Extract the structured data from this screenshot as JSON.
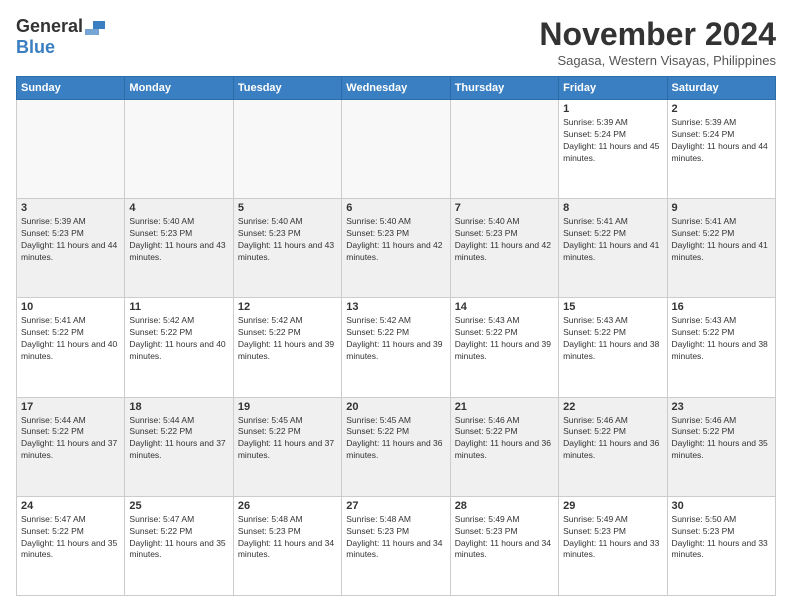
{
  "logo": {
    "general": "General",
    "blue": "Blue"
  },
  "header": {
    "month": "November 2024",
    "location": "Sagasa, Western Visayas, Philippines"
  },
  "weekdays": [
    "Sunday",
    "Monday",
    "Tuesday",
    "Wednesday",
    "Thursday",
    "Friday",
    "Saturday"
  ],
  "weeks": [
    [
      {
        "day": "",
        "info": ""
      },
      {
        "day": "",
        "info": ""
      },
      {
        "day": "",
        "info": ""
      },
      {
        "day": "",
        "info": ""
      },
      {
        "day": "",
        "info": ""
      },
      {
        "day": "1",
        "info": "Sunrise: 5:39 AM\nSunset: 5:24 PM\nDaylight: 11 hours and 45 minutes."
      },
      {
        "day": "2",
        "info": "Sunrise: 5:39 AM\nSunset: 5:24 PM\nDaylight: 11 hours and 44 minutes."
      }
    ],
    [
      {
        "day": "3",
        "info": "Sunrise: 5:39 AM\nSunset: 5:23 PM\nDaylight: 11 hours and 44 minutes."
      },
      {
        "day": "4",
        "info": "Sunrise: 5:40 AM\nSunset: 5:23 PM\nDaylight: 11 hours and 43 minutes."
      },
      {
        "day": "5",
        "info": "Sunrise: 5:40 AM\nSunset: 5:23 PM\nDaylight: 11 hours and 43 minutes."
      },
      {
        "day": "6",
        "info": "Sunrise: 5:40 AM\nSunset: 5:23 PM\nDaylight: 11 hours and 42 minutes."
      },
      {
        "day": "7",
        "info": "Sunrise: 5:40 AM\nSunset: 5:23 PM\nDaylight: 11 hours and 42 minutes."
      },
      {
        "day": "8",
        "info": "Sunrise: 5:41 AM\nSunset: 5:22 PM\nDaylight: 11 hours and 41 minutes."
      },
      {
        "day": "9",
        "info": "Sunrise: 5:41 AM\nSunset: 5:22 PM\nDaylight: 11 hours and 41 minutes."
      }
    ],
    [
      {
        "day": "10",
        "info": "Sunrise: 5:41 AM\nSunset: 5:22 PM\nDaylight: 11 hours and 40 minutes."
      },
      {
        "day": "11",
        "info": "Sunrise: 5:42 AM\nSunset: 5:22 PM\nDaylight: 11 hours and 40 minutes."
      },
      {
        "day": "12",
        "info": "Sunrise: 5:42 AM\nSunset: 5:22 PM\nDaylight: 11 hours and 39 minutes."
      },
      {
        "day": "13",
        "info": "Sunrise: 5:42 AM\nSunset: 5:22 PM\nDaylight: 11 hours and 39 minutes."
      },
      {
        "day": "14",
        "info": "Sunrise: 5:43 AM\nSunset: 5:22 PM\nDaylight: 11 hours and 39 minutes."
      },
      {
        "day": "15",
        "info": "Sunrise: 5:43 AM\nSunset: 5:22 PM\nDaylight: 11 hours and 38 minutes."
      },
      {
        "day": "16",
        "info": "Sunrise: 5:43 AM\nSunset: 5:22 PM\nDaylight: 11 hours and 38 minutes."
      }
    ],
    [
      {
        "day": "17",
        "info": "Sunrise: 5:44 AM\nSunset: 5:22 PM\nDaylight: 11 hours and 37 minutes."
      },
      {
        "day": "18",
        "info": "Sunrise: 5:44 AM\nSunset: 5:22 PM\nDaylight: 11 hours and 37 minutes."
      },
      {
        "day": "19",
        "info": "Sunrise: 5:45 AM\nSunset: 5:22 PM\nDaylight: 11 hours and 37 minutes."
      },
      {
        "day": "20",
        "info": "Sunrise: 5:45 AM\nSunset: 5:22 PM\nDaylight: 11 hours and 36 minutes."
      },
      {
        "day": "21",
        "info": "Sunrise: 5:46 AM\nSunset: 5:22 PM\nDaylight: 11 hours and 36 minutes."
      },
      {
        "day": "22",
        "info": "Sunrise: 5:46 AM\nSunset: 5:22 PM\nDaylight: 11 hours and 36 minutes."
      },
      {
        "day": "23",
        "info": "Sunrise: 5:46 AM\nSunset: 5:22 PM\nDaylight: 11 hours and 35 minutes."
      }
    ],
    [
      {
        "day": "24",
        "info": "Sunrise: 5:47 AM\nSunset: 5:22 PM\nDaylight: 11 hours and 35 minutes."
      },
      {
        "day": "25",
        "info": "Sunrise: 5:47 AM\nSunset: 5:22 PM\nDaylight: 11 hours and 35 minutes."
      },
      {
        "day": "26",
        "info": "Sunrise: 5:48 AM\nSunset: 5:23 PM\nDaylight: 11 hours and 34 minutes."
      },
      {
        "day": "27",
        "info": "Sunrise: 5:48 AM\nSunset: 5:23 PM\nDaylight: 11 hours and 34 minutes."
      },
      {
        "day": "28",
        "info": "Sunrise: 5:49 AM\nSunset: 5:23 PM\nDaylight: 11 hours and 34 minutes."
      },
      {
        "day": "29",
        "info": "Sunrise: 5:49 AM\nSunset: 5:23 PM\nDaylight: 11 hours and 33 minutes."
      },
      {
        "day": "30",
        "info": "Sunrise: 5:50 AM\nSunset: 5:23 PM\nDaylight: 11 hours and 33 minutes."
      }
    ]
  ]
}
